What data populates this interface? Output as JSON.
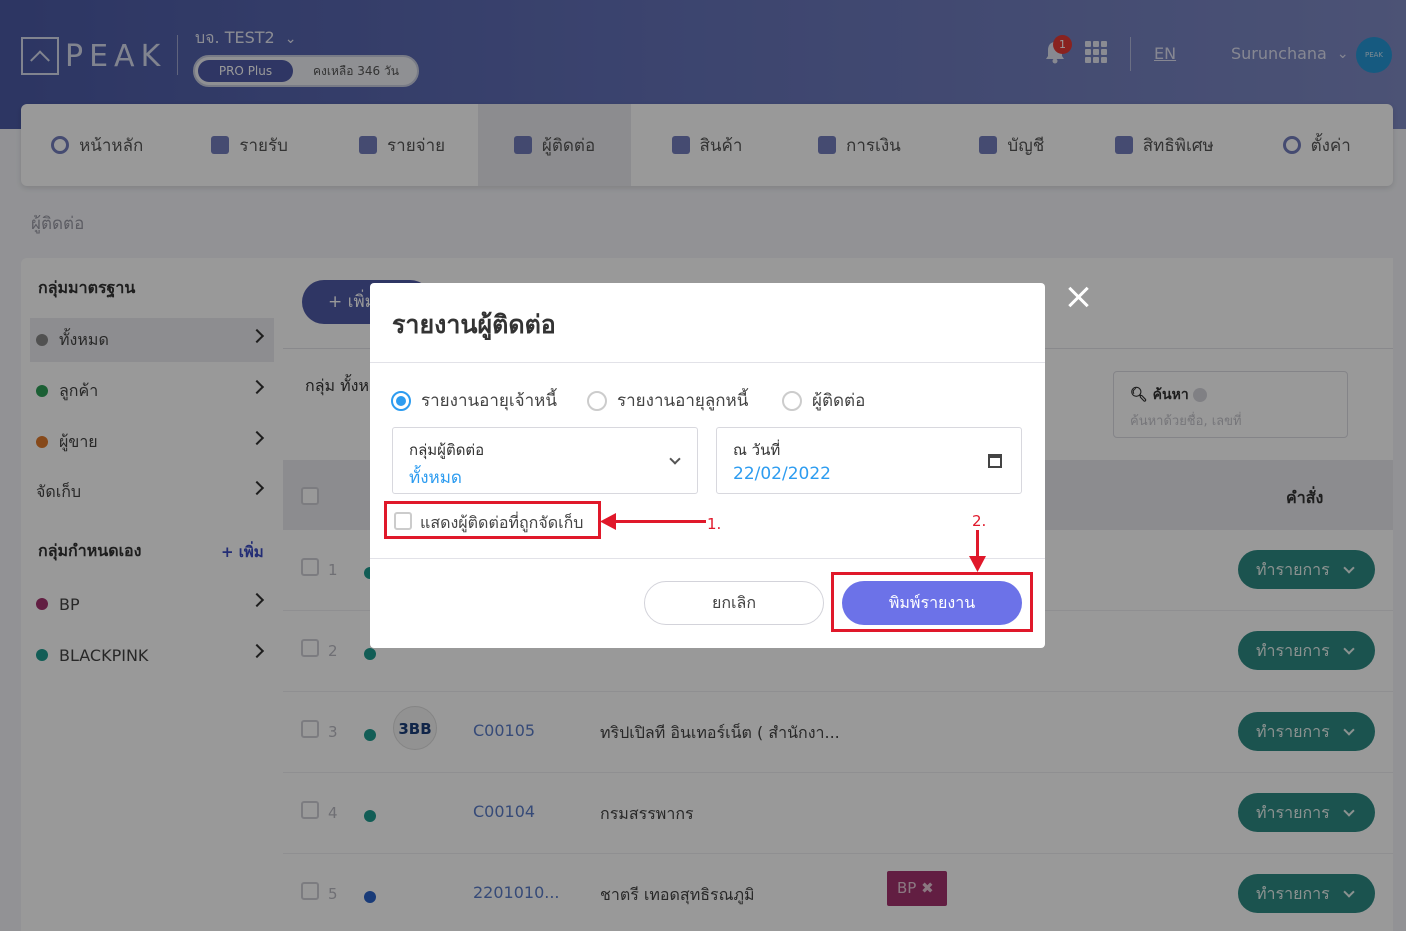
{
  "header": {
    "logo_text": "PEAK",
    "company": "บจ. TEST2",
    "plan": "PRO Plus",
    "remaining": "คงเหลือ 346 วัน",
    "notifications": "1",
    "lang": "EN",
    "user": "Surunchana",
    "avatar_text": "PEAK"
  },
  "nav": [
    {
      "label": "หน้าหลัก",
      "icon": "dashboard-icon"
    },
    {
      "label": "รายรับ",
      "icon": "income-list-icon"
    },
    {
      "label": "รายจ่าย",
      "icon": "expense-list-icon"
    },
    {
      "label": "ผู้ติดต่อ",
      "icon": "contacts-building-icon"
    },
    {
      "label": "สินค้า",
      "icon": "box-icon"
    },
    {
      "label": "การเงิน",
      "icon": "money-icon"
    },
    {
      "label": "บัญชี",
      "icon": "ledger-icon"
    },
    {
      "label": "สิทธิพิเศษ",
      "icon": "megaphone-icon"
    },
    {
      "label": "ตั้งค่า",
      "icon": "gear-icon"
    }
  ],
  "breadcrumb": "ผู้ติดต่อ",
  "sidebar": {
    "standard_title": "กลุ่มมาตรฐาน",
    "standard_items": [
      {
        "label": "ทั้งหมด",
        "color": "#888888"
      },
      {
        "label": "ลูกค้า",
        "color": "#2e9e57"
      },
      {
        "label": "ผู้ขาย",
        "color": "#e07a2c"
      },
      {
        "label": "จัดเก็บ",
        "color": ""
      }
    ],
    "custom_title": "กลุ่มกำหนดเอง",
    "custom_add": "+ เพิ่ม",
    "custom_items": [
      {
        "label": "BP",
        "color": "#a3336f"
      },
      {
        "label": "BLACKPINK",
        "color": "#1f9c8f"
      }
    ]
  },
  "main": {
    "add_button": "+ เพิ่ม",
    "group_label": "กลุ่ม ทั้งห",
    "search_label": "ค้นหา",
    "search_placeholder": "ค้นหาด้วยชื่อ, เลขที่",
    "col_command": "คำสั่ง",
    "action_label": "ทำรายการ",
    "rows": [
      {
        "num": "1",
        "code": "",
        "name": "",
        "dot": "#1f9c8f"
      },
      {
        "num": "2",
        "code": "",
        "name": "",
        "dot": "#1f9c8f"
      },
      {
        "num": "3",
        "code": "C00105",
        "name": "ทริปเปิลที อินเทอร์เน็ต ( สำนักงา...",
        "dot": "#1f9c8f",
        "logo": "3BB"
      },
      {
        "num": "4",
        "code": "C00104",
        "name": "กรมสรรพากร",
        "dot": "#1f9c8f"
      },
      {
        "num": "5",
        "code": "2201010...",
        "name": "ชาตรี เทอดสุทธิรณภูมิ",
        "dot": "#2b63c9",
        "tag": "BP ✖"
      }
    ]
  },
  "modal": {
    "title": "รายงานผู้ติดต่อ",
    "radios": [
      {
        "label": "รายงานอายุเจ้าหนี้",
        "checked": true
      },
      {
        "label": "รายงานอายุลูกหนี้",
        "checked": false
      },
      {
        "label": "ผู้ติดต่อ",
        "checked": false
      }
    ],
    "group_field_label": "กลุ่มผู้ติดต่อ",
    "group_field_value": "ทั้งหมด",
    "date_field_label": "ณ วันที่",
    "date_field_value": "22/02/2022",
    "show_archived": "แสดงผู้ติดต่อที่ถูกจัดเก็บ",
    "cancel": "ยกเลิก",
    "print": "พิมพ์รายงาน"
  },
  "annotations": {
    "one": "1.",
    "two": "2."
  },
  "colors": {
    "accent": "#4f5aa7",
    "primary_button": "#6c72e8",
    "action": "#2e8b84",
    "highlight": "#e0182a"
  }
}
